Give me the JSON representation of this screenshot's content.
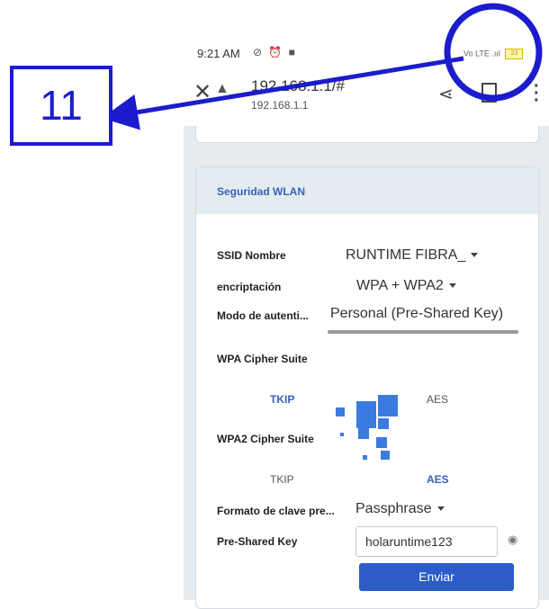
{
  "status_bar": {
    "time": "9:21 AM",
    "icons": "⊘ ⏰ ■",
    "network": "Vo LTE",
    "battery": "23"
  },
  "browser": {
    "url": "192.168.1.1/#",
    "host": "192.168.1.1"
  },
  "card": {
    "title": "Seguridad WLAN",
    "ssid_label": "SSID Nombre",
    "ssid_value": "RUNTIME FIBRA_",
    "encryption_label": "encriptación",
    "encryption_value": "WPA + WPA2",
    "auth_label": "Modo de autenti...",
    "auth_value": "Personal (Pre-Shared Key)",
    "wpa_cipher_label": "WPA Cipher Suite",
    "wpa_tkip": "TKIP",
    "wpa_aes": "AES",
    "wpa2_cipher_label": "WPA2 Cipher Suite",
    "wpa2_tkip": "TKIP",
    "wpa2_aes": "AES",
    "key_format_label": "Formato de clave pre...",
    "key_format_value": "Passphrase",
    "psk_label": "Pre-Shared Key",
    "psk_value": "holaruntime123",
    "submit_label": "Enviar"
  },
  "annotation": {
    "number": "11",
    "color": "#1c1ccc"
  },
  "colors": {
    "accent": "#3a62b8",
    "button": "#2d5cc9",
    "page_bg": "#e6ebef"
  }
}
